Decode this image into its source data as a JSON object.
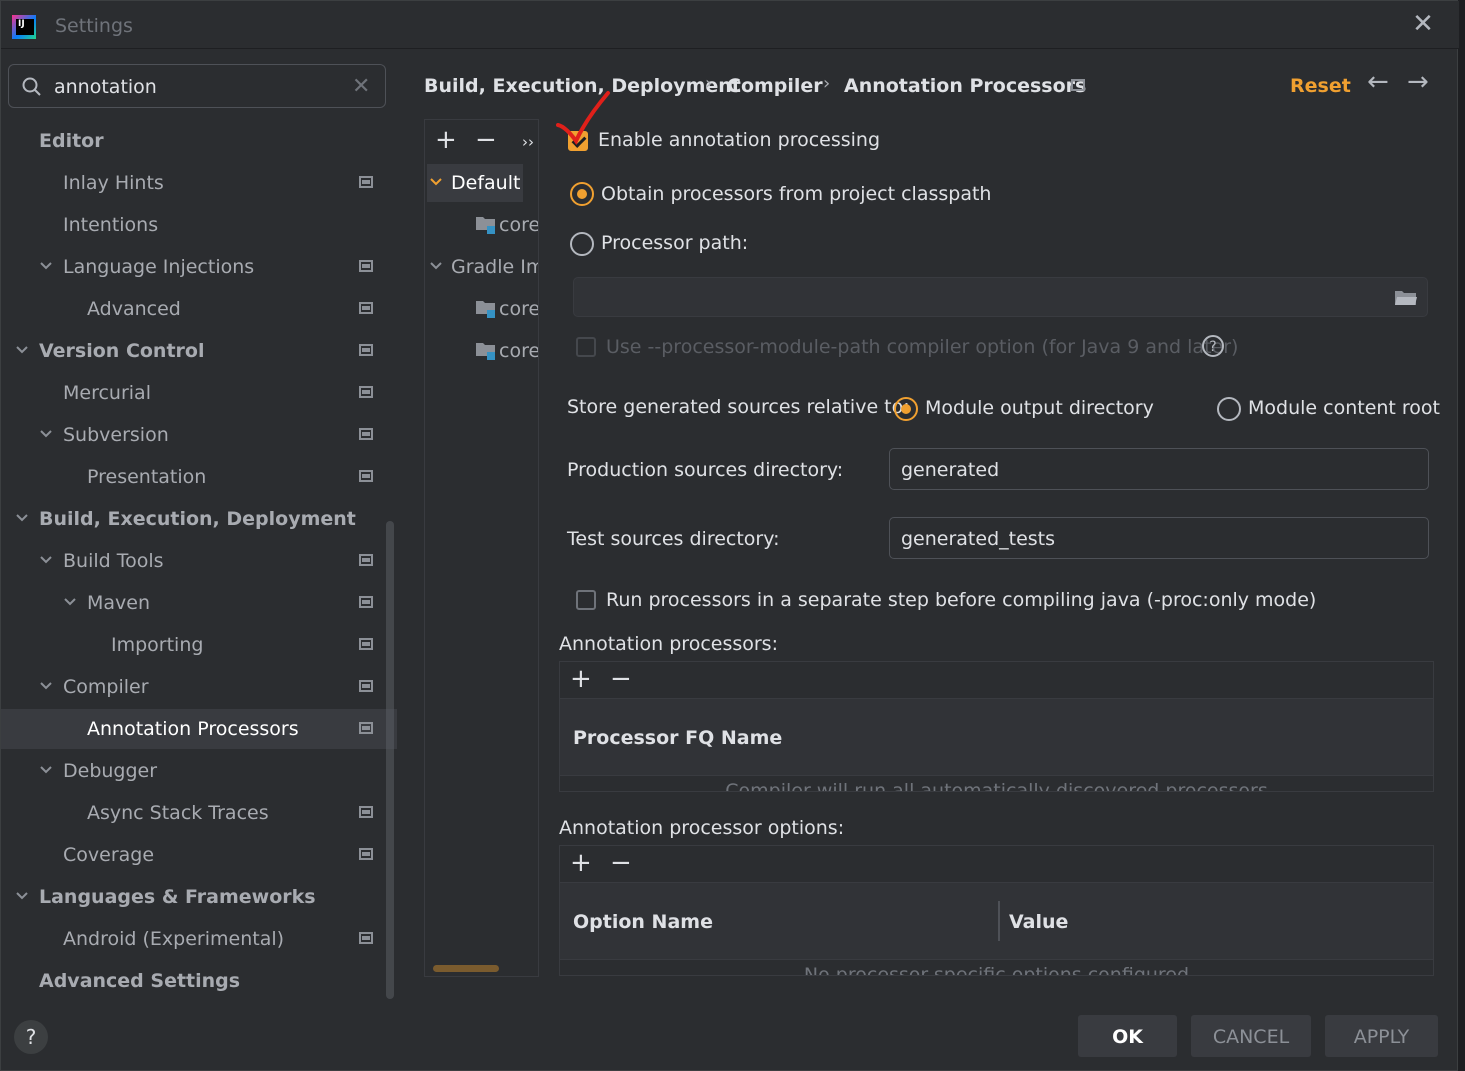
{
  "window": {
    "title": "Settings"
  },
  "search": {
    "value": "annotation"
  },
  "tree": [
    {
      "label": "Editor",
      "level": 0,
      "bold": true,
      "chevron": false,
      "proj": false
    },
    {
      "label": "Inlay Hints",
      "level": 1,
      "bold": false,
      "chevron": false,
      "proj": true
    },
    {
      "label": "Intentions",
      "level": 1,
      "bold": false,
      "chevron": false,
      "proj": false
    },
    {
      "label": "Language Injections",
      "level": 1,
      "bold": false,
      "chevron": true,
      "proj": true
    },
    {
      "label": "Advanced",
      "level": 2,
      "bold": false,
      "chevron": false,
      "proj": true
    },
    {
      "label": "Version Control",
      "level": 0,
      "bold": true,
      "chevron": true,
      "proj": true
    },
    {
      "label": "Mercurial",
      "level": 1,
      "bold": false,
      "chevron": false,
      "proj": true
    },
    {
      "label": "Subversion",
      "level": 1,
      "bold": false,
      "chevron": true,
      "proj": true
    },
    {
      "label": "Presentation",
      "level": 2,
      "bold": false,
      "chevron": false,
      "proj": true
    },
    {
      "label": "Build, Execution, Deployment",
      "level": 0,
      "bold": true,
      "chevron": true,
      "proj": false
    },
    {
      "label": "Build Tools",
      "level": 1,
      "bold": false,
      "chevron": true,
      "proj": true
    },
    {
      "label": "Maven",
      "level": 2,
      "bold": false,
      "chevron": true,
      "proj": true
    },
    {
      "label": "Importing",
      "level": 3,
      "bold": false,
      "chevron": false,
      "proj": true
    },
    {
      "label": "Compiler",
      "level": 1,
      "bold": false,
      "chevron": true,
      "proj": true
    },
    {
      "label": "Annotation Processors",
      "level": 2,
      "bold": false,
      "chevron": false,
      "proj": true,
      "selected": true
    },
    {
      "label": "Debugger",
      "level": 1,
      "bold": false,
      "chevron": true,
      "proj": false
    },
    {
      "label": "Async Stack Traces",
      "level": 2,
      "bold": false,
      "chevron": false,
      "proj": true
    },
    {
      "label": "Coverage",
      "level": 1,
      "bold": false,
      "chevron": false,
      "proj": true
    },
    {
      "label": "Languages & Frameworks",
      "level": 0,
      "bold": true,
      "chevron": true,
      "proj": false
    },
    {
      "label": "Android (Experimental)",
      "level": 1,
      "bold": false,
      "chevron": false,
      "proj": true
    },
    {
      "label": "Advanced Settings",
      "level": 0,
      "bold": true,
      "chevron": false,
      "proj": false
    }
  ],
  "breadcrumb": [
    "Build, Execution, Deployment",
    "Compiler",
    "Annotation Processors"
  ],
  "reset_label": "Reset",
  "profiles": {
    "more": "››",
    "items": [
      {
        "label": "Default",
        "type": "group",
        "selected": true
      },
      {
        "label": "core",
        "type": "module"
      },
      {
        "label": "Gradle Imp",
        "type": "group"
      },
      {
        "label": "core",
        "type": "module"
      },
      {
        "label": "core",
        "type": "module"
      }
    ]
  },
  "options": {
    "enable_label": "Enable annotation processing",
    "enable_checked": true,
    "obtain_label": "Obtain processors from project classpath",
    "processor_path_label": "Processor path:",
    "processor_path_value": "",
    "module_path_label": "Use --processor-module-path compiler option (for Java 9 and later)",
    "store_label": "Store generated sources relative to:",
    "module_output_label": "Module output directory",
    "module_content_label": "Module content root",
    "production_label": "Production sources directory:",
    "production_value": "generated",
    "test_label": "Test sources directory:",
    "test_value": "generated_tests",
    "run_separate_label": "Run processors in a separate step before compiling java (-proc:only mode)"
  },
  "processors_table": {
    "title": "Annotation processors:",
    "header": "Processor FQ Name",
    "empty_text": "Compiler will run all automatically discovered processors"
  },
  "options_table": {
    "title": "Annotation processor options:",
    "header_name": "Option Name",
    "header_value": "Value",
    "empty_text": "No processor-specific options configured"
  },
  "buttons": {
    "ok": "OK",
    "cancel": "CANCEL",
    "apply": "APPLY"
  },
  "colors": {
    "accent": "#f0a030",
    "background": "#2b2d30",
    "selected": "#393b40"
  }
}
